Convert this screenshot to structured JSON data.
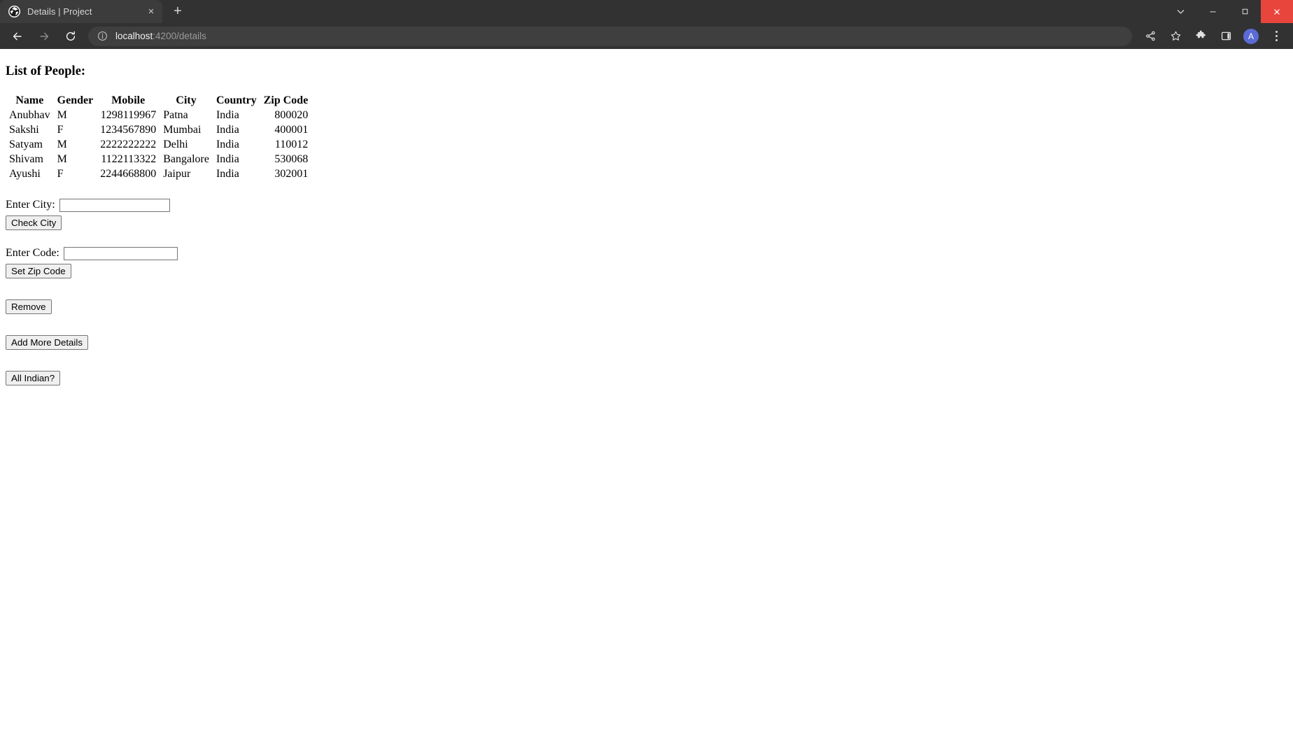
{
  "browser": {
    "tab": {
      "title": "Details | Project",
      "favicon_name": "angular-globe-favicon",
      "close_label": "×"
    },
    "new_tab_label": "+",
    "window_controls": {
      "tab_search_label": "⌄",
      "minimize_label": "–",
      "maximize_label": "□",
      "close_label": "✕"
    },
    "toolbar": {
      "back_label": "←",
      "forward_label": "→",
      "reload_label": "↻",
      "site_info_label": "ⓘ",
      "url_host": "localhost",
      "url_path": ":4200/details",
      "share_label": "share-icon",
      "bookmark_label": "☆",
      "extensions_label": "extensions-icon",
      "side_panel_label": "side-panel-icon",
      "profile_initial": "A",
      "menu_label": "⋮"
    },
    "accent": {
      "close_red": "#e8453c",
      "avatar_blue": "#5b6bd6",
      "chrome_dark": "#323232",
      "omnibox_bg": "#3f3f3f"
    }
  },
  "page": {
    "title": "List of People:",
    "table": {
      "columns": [
        "Name",
        "Gender",
        "Mobile",
        "City",
        "Country",
        "Zip Code"
      ],
      "rows": [
        {
          "name": "Anubhav",
          "gender": "M",
          "mobile": "1298119967",
          "city": "Patna",
          "country": "India",
          "zip": "800020"
        },
        {
          "name": "Sakshi",
          "gender": "F",
          "mobile": "1234567890",
          "city": "Mumbai",
          "country": "India",
          "zip": "400001"
        },
        {
          "name": "Satyam",
          "gender": "M",
          "mobile": "2222222222",
          "city": "Delhi",
          "country": "India",
          "zip": "110012"
        },
        {
          "name": "Shivam",
          "gender": "M",
          "mobile": "1122113322",
          "city": "Bangalore",
          "country": "India",
          "zip": "530068"
        },
        {
          "name": "Ayushi",
          "gender": "F",
          "mobile": "2244668800",
          "city": "Jaipur",
          "country": "India",
          "zip": "302001"
        }
      ]
    },
    "form": {
      "city_label": "Enter City:",
      "city_value": "",
      "city_placeholder": "",
      "check_city_label": "Check City",
      "code_label": "Enter Code:",
      "code_value": "",
      "code_placeholder": "",
      "set_zip_label": "Set Zip Code"
    },
    "actions": {
      "remove_label": "Remove",
      "add_more_label": "Add More Details",
      "all_indian_label": "All Indian?"
    }
  }
}
